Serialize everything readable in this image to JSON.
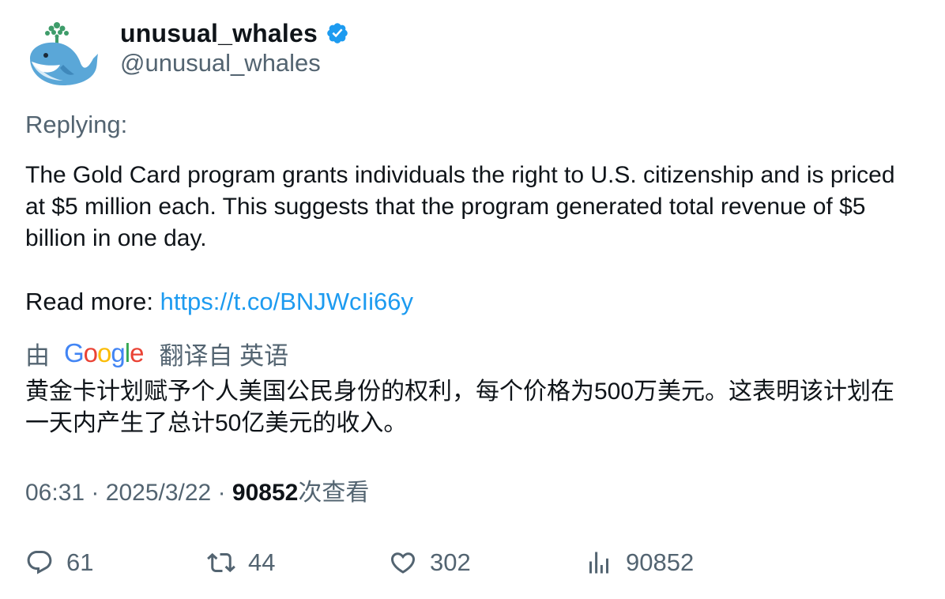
{
  "author": {
    "display_name": "unusual_whales",
    "handle": "@unusual_whales",
    "verified": true,
    "avatar_icon": "whale-avatar-icon",
    "verified_icon": "verified-badge-icon",
    "verified_color": "#1d9bf0"
  },
  "replying_label": "Replying:",
  "tweet": {
    "text": "The Gold Card program grants individuals the right to U.S. citizenship and is priced at $5 million each.  This suggests that the program generated total revenue of $5 billion in one day.",
    "read_more_label": "Read more: ",
    "link_text": "https://t.co/BNJWcIi66y"
  },
  "translation": {
    "by_label": "由",
    "provider": "Google",
    "from_label": "翻译自 英语",
    "text": "黄金卡计划赋予个人美国公民身份的权利，每个价格为500万美元。这表明该计划在一天内产生了总计50亿美元的收入。"
  },
  "meta": {
    "time": "06:31",
    "separator": "·",
    "date": "2025/3/22",
    "views_count": "90852",
    "views_label": "次查看"
  },
  "actions": {
    "reply": {
      "icon": "reply-icon",
      "count": "61"
    },
    "retweet": {
      "icon": "retweet-icon",
      "count": "44"
    },
    "like": {
      "icon": "heart-icon",
      "count": "302"
    },
    "views": {
      "icon": "analytics-icon",
      "count": "90852"
    }
  },
  "colors": {
    "text_primary": "#0f1419",
    "text_secondary": "#536471",
    "link": "#1d9bf0"
  }
}
